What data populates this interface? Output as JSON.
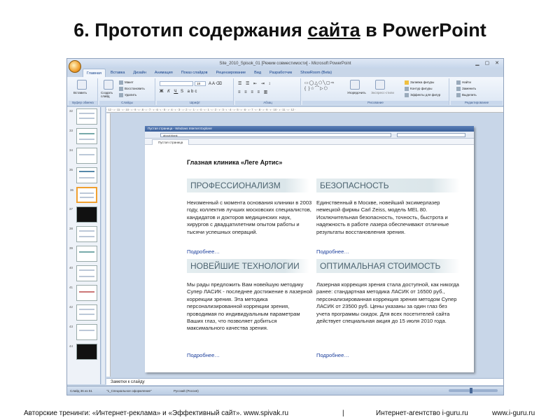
{
  "title": {
    "prefix": "6. Прототип содержания ",
    "underlined": "сайта",
    "suffix": " в PowerPoint"
  },
  "ppt": {
    "window_title": "Site_2010_Spisok_01 [Режим совместимости] - Microsoft PowerPoint",
    "tabs": [
      "Главная",
      "Вставка",
      "Дизайн",
      "Анимация",
      "Показ слайдов",
      "Рецензирование",
      "Вид",
      "Разработчик",
      "ShowRoom (Beta)"
    ],
    "ribbon": {
      "paste": "Вставить",
      "create_slide": "Создать слайд",
      "layout": "Макет",
      "restore": "Восстановить",
      "delete": "Удалить",
      "font_size": "18",
      "arrange": "Упорядочить",
      "quick_styles": "Экспресс-стили",
      "fill": "Заливка фигуры",
      "outline": "Контур фигуры",
      "effects": "Эффекты для фигур",
      "find": "Найти",
      "replace": "Заменить",
      "select": "Выделить",
      "groups": {
        "clipboard": "Буфер обмена",
        "slides": "Слайды",
        "font": "Шрифт",
        "paragraph": "Абзац",
        "drawing": "Рисование",
        "editing": "Редактирование"
      }
    },
    "ruler_text": "· 12 · ı · 11 · ı · 10 · ı · 9 · ı · 8 · ı · 7 · ı · 6 · ı · 5 · ı · 4 · ı · 3 · ı · 2 · ı · 1 · ı · 0 · ı · 1 · ı · 2 · ı · 3 · ı · 4 · ı · 5 · ı · 6 · ı · 7 · ı · 8 · ı · 9 · ı · 10 · ı · 11 · ı · 12 ·",
    "thumb_numbers": [
      "32",
      "33",
      "34",
      "35",
      "36",
      "37",
      "38",
      "39",
      "40",
      "41",
      "42",
      "43",
      "44"
    ],
    "browser": {
      "title": "Пустая страница - Windows Internet Explorer",
      "address": "about:blank",
      "tab": "Пустая страница"
    },
    "slide": {
      "clinic_title": "Глазная клиника «Леге Артис»",
      "sections": [
        {
          "heading": "ПРОФЕССИОНАЛИЗМ",
          "text": "Неизменный с момента основания клиники в 2003 году, коллектив лучших московских специалистов, кандидатов и докторов медицинских наук, хирургов с двадцатилетним опытом работы и тысячи успешных операций.",
          "more": "Подробнее…"
        },
        {
          "heading": "БЕЗОПАСНОСТЬ",
          "text": "Единственный в Москве, новейший эксимерлазер немецкой фирмы Carl Zeiss, модель MEL 80. Исключительная безопасность, точность, быстрота и надежность в работе лазера обеспечивают отличные результаты восстановления зрения.",
          "more": "Подробнее…"
        },
        {
          "heading": "НОВЕЙШИЕ ТЕХНОЛОГИИ",
          "text": "Мы рады предложить Вам новейшую методику Супер ЛАСИК - последнее достижение в лазерной коррекции зрения. Эта методика персонализированной коррекции зрения, проводимая по индивидуальным параметрам Ваших глаз, что позволяет добиться максимального качества зрения.",
          "more": "Подробнее…"
        },
        {
          "heading": "ОПТИМАЛЬНАЯ СТОИМОСТЬ",
          "text": "Лазерная коррекция зрения стала доступной, как никогда ранее: стандартная методика ЛАСИК от 16500 руб., персонализированная коррекция зрения методом Супер ЛАСИК от 23500 руб. Цены указаны за один глаз без учета программы скидок. Для всех посетителей сайта действует специальная акция до 15 июля 2010 года.",
          "more": "Подробнее…"
        }
      ]
    },
    "notes_placeholder": "Заметки к слайду",
    "status": {
      "slide_counter": "Слайд 36 из 51",
      "theme": "\"1_Специальное оформление\"",
      "language": "Русский (Россия)"
    }
  },
  "footer": {
    "left": "Авторские тренинги: «Интернет-реклама» и «Эффективный сайт». www.spivak.ru",
    "separator": "|",
    "middle": "Интернет-агентство i-guru.ru",
    "right": "www.i-guru.ru"
  },
  "colors": {
    "banner_bg": "#dbe6ea",
    "banner_text": "#4d6470",
    "link": "#1c3f9c",
    "selected_thumb": "#f0a030"
  }
}
